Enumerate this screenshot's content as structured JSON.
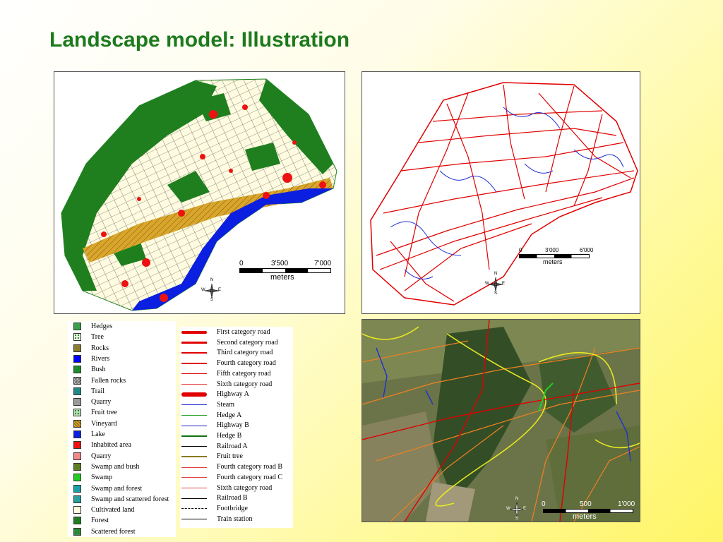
{
  "title": "Landscape model: Illustration",
  "maps": {
    "landuse": {
      "scale_ticks": [
        "0",
        "3'500",
        "7'000"
      ],
      "scale_unit": "meters",
      "compass": {
        "n": "N",
        "s": "S",
        "e": "E",
        "w": "W"
      }
    },
    "roads": {
      "scale_ticks": [
        "0",
        "3'000",
        "6'000"
      ],
      "scale_unit": "meters",
      "compass": {
        "n": "N",
        "s": "S",
        "e": "E",
        "w": "W"
      }
    },
    "aerial": {
      "scale_ticks": [
        "0",
        "500",
        "1'000"
      ],
      "scale_unit": "meters",
      "compass": {
        "n": "N",
        "s": "S",
        "e": "E",
        "w": "W"
      }
    }
  },
  "legend_landuse": [
    {
      "label": "Hedges",
      "color": "#3aa04a",
      "pattern": "icon"
    },
    {
      "label": "Tree",
      "color": "#e8f4e0",
      "pattern": "dots"
    },
    {
      "label": "Rocks",
      "color": "#8b7d2b"
    },
    {
      "label": "Rivers",
      "color": "#0000ff"
    },
    {
      "label": "Bush",
      "color": "#1e8c2a"
    },
    {
      "label": "Fallen rocks",
      "color": "#c8c8c8",
      "pattern": "cross"
    },
    {
      "label": "Trail",
      "color": "#208a8a"
    },
    {
      "label": "Quarry",
      "color": "#9a9a9a"
    },
    {
      "label": "Fruit tree",
      "color": "#b8e0b8",
      "pattern": "dots"
    },
    {
      "label": "Vineyard",
      "color": "#d9a52b",
      "pattern": "hatch"
    },
    {
      "label": "Lake",
      "color": "#0b1fe0"
    },
    {
      "label": "Inhabited area",
      "color": "#ee1111"
    },
    {
      "label": "Quarry",
      "color": "#f08a8a"
    },
    {
      "label": "Swamp and bush",
      "color": "#5e7f22"
    },
    {
      "label": "Swamp",
      "color": "#22cc22"
    },
    {
      "label": "Swamp and forest",
      "color": "#1aa0a8"
    },
    {
      "label": "Swamp and scattered forest",
      "color": "#2a9f9f"
    },
    {
      "label": "Cultivated land",
      "color": "#fffbe0"
    },
    {
      "label": "Forest",
      "color": "#1f7f1f"
    },
    {
      "label": "Scattered forest",
      "color": "#2f8f3f",
      "pattern": "dots"
    }
  ],
  "legend_roads": [
    {
      "label": "First category road",
      "color": "#e00000",
      "width": 4
    },
    {
      "label": "Second category road",
      "color": "#e00000",
      "width": 3
    },
    {
      "label": "Third category road",
      "color": "#e00000",
      "width": 2
    },
    {
      "label": "Fourth category road",
      "color": "#e00000",
      "width": 2
    },
    {
      "label": "Fifth category road",
      "color": "#e00000",
      "width": 1
    },
    {
      "label": "Sixth category road",
      "color": "#e84040",
      "width": 1
    },
    {
      "label": "Highway A",
      "color": "#e00000",
      "width": 6
    },
    {
      "label": "Steam",
      "color": "#2030d0",
      "width": 1
    },
    {
      "label": "Hedge A",
      "color": "#20a020",
      "width": 1
    },
    {
      "label": "Highway B",
      "color": "#2020c0",
      "width": 1
    },
    {
      "label": "Hedge B",
      "color": "#107010",
      "width": 2
    },
    {
      "label": "Railroad A",
      "color": "#000000",
      "width": 1
    },
    {
      "label": "Fruit tree",
      "color": "#8a7a20",
      "width": 2
    },
    {
      "label": "Fourth category road B",
      "color": "#e04040",
      "width": 1
    },
    {
      "label": "Fourth category road C",
      "color": "#e04040",
      "width": 1
    },
    {
      "label": "Sixth category road",
      "color": "#e84040",
      "width": 1
    },
    {
      "label": "Railroad B",
      "color": "#000000",
      "width": 1
    },
    {
      "label": "Footbridge",
      "color": "#000000",
      "width": 1,
      "dashed": true
    },
    {
      "label": "Train station",
      "color": "#000000",
      "width": 1
    }
  ]
}
